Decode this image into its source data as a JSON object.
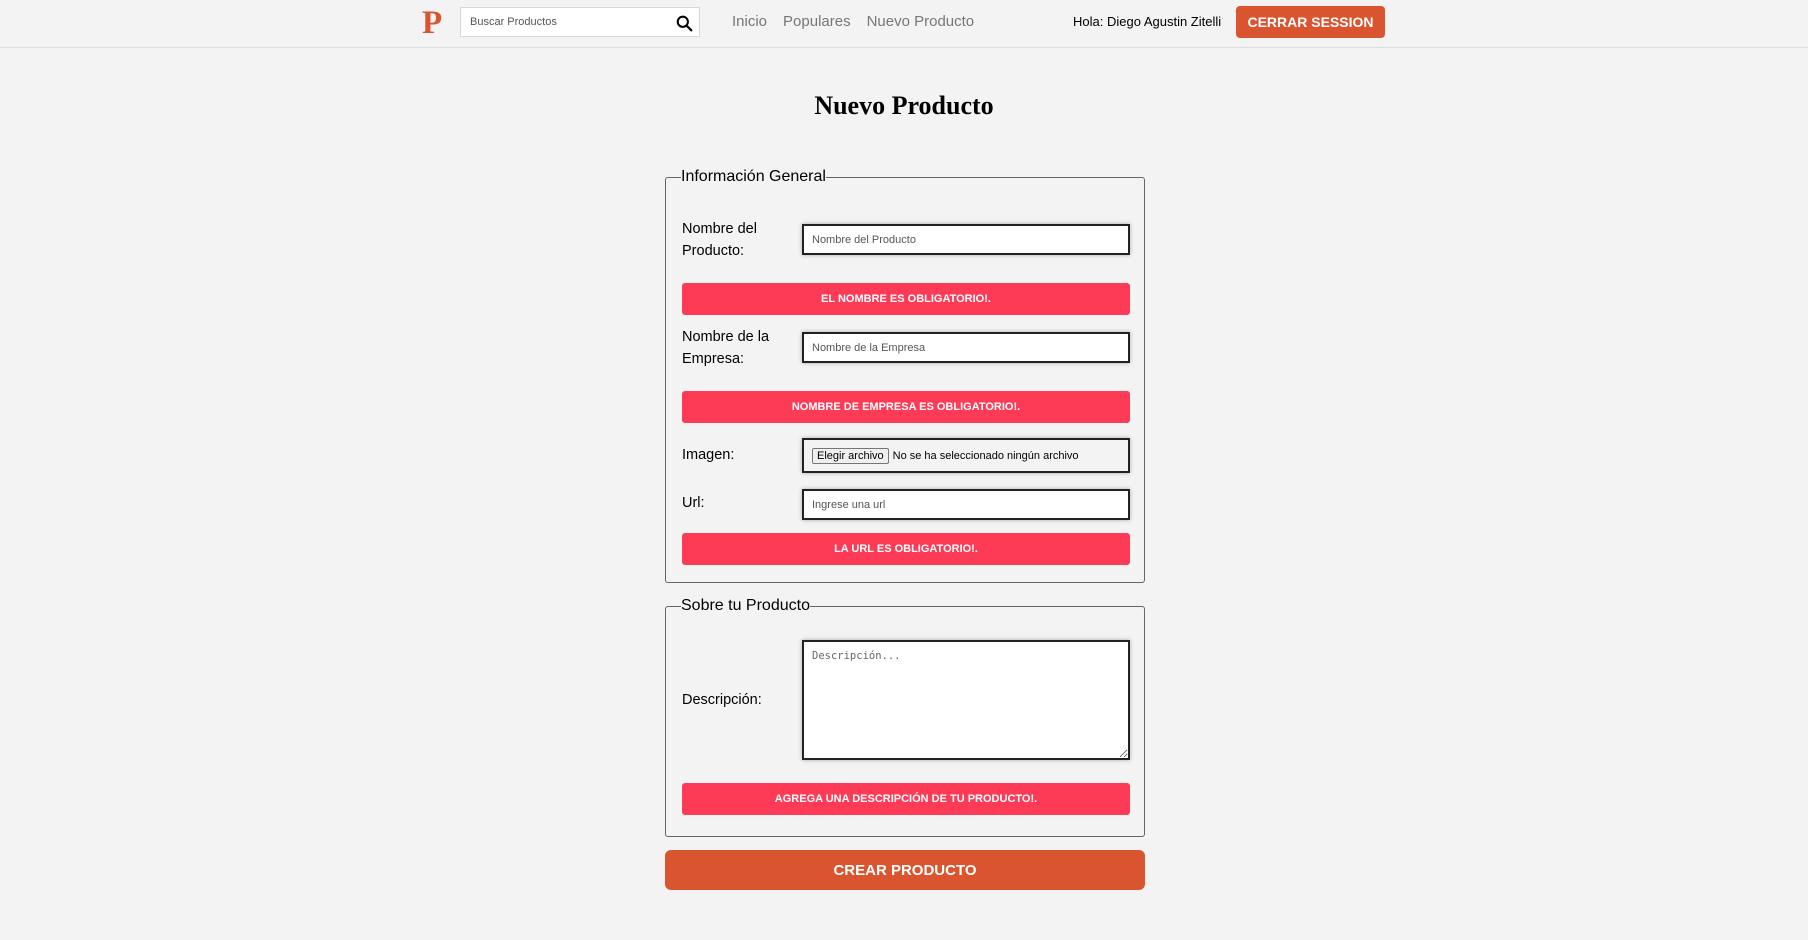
{
  "header": {
    "logo": "P",
    "search_placeholder": "Buscar Productos",
    "nav": [
      "Inicio",
      "Populares",
      "Nuevo Producto"
    ],
    "greeting": "Hola: Diego Agustin Zitelli",
    "logout_label": "Cerrar Session"
  },
  "main": {
    "title": "Nuevo Producto",
    "general": {
      "legend": "Información General",
      "name_label": "Nombre del Producto:",
      "name_placeholder": "Nombre del Producto",
      "name_error": "El nombre es obligatorio!.",
      "company_label": "Nombre de la Empresa:",
      "company_placeholder": "Nombre de la Empresa",
      "company_error": "Nombre de empresa es obligatorio!.",
      "image_label": "Imagen:",
      "file_button": "Elegir archivo",
      "file_status": "No se ha seleccionado ningún archivo",
      "url_label": "Url:",
      "url_placeholder": "Ingrese una url",
      "url_error": "La url es obligatorio!."
    },
    "about": {
      "legend": "Sobre tu Producto",
      "description_label": "Descripción:",
      "description_placeholder": "Descripción...",
      "description_error": "Agrega una descripción de tu producto!."
    },
    "submit_label": "Crear Producto"
  },
  "colors": {
    "brand": "#da552f",
    "error": "#fe3b57",
    "background": "#f3f3f3"
  }
}
